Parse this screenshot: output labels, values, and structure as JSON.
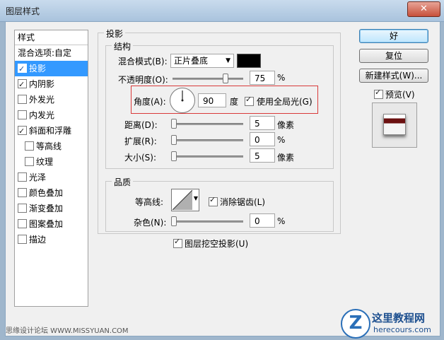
{
  "window": {
    "title": "图层样式",
    "close_label": "✕"
  },
  "left_panel": {
    "header": "样式",
    "items": [
      {
        "label": "混合选项:自定",
        "checkbox": false,
        "checked": false,
        "selected": false,
        "indent": false
      },
      {
        "label": "投影",
        "checkbox": true,
        "checked": true,
        "selected": true,
        "indent": false
      },
      {
        "label": "内阴影",
        "checkbox": true,
        "checked": true,
        "selected": false,
        "indent": false
      },
      {
        "label": "外发光",
        "checkbox": true,
        "checked": false,
        "selected": false,
        "indent": false
      },
      {
        "label": "内发光",
        "checkbox": true,
        "checked": false,
        "selected": false,
        "indent": false
      },
      {
        "label": "斜面和浮雕",
        "checkbox": true,
        "checked": true,
        "selected": false,
        "indent": false
      },
      {
        "label": "等高线",
        "checkbox": true,
        "checked": false,
        "selected": false,
        "indent": true
      },
      {
        "label": "纹理",
        "checkbox": true,
        "checked": false,
        "selected": false,
        "indent": true
      },
      {
        "label": "光泽",
        "checkbox": true,
        "checked": false,
        "selected": false,
        "indent": false
      },
      {
        "label": "颜色叠加",
        "checkbox": true,
        "checked": false,
        "selected": false,
        "indent": false
      },
      {
        "label": "渐变叠加",
        "checkbox": true,
        "checked": false,
        "selected": false,
        "indent": false
      },
      {
        "label": "图案叠加",
        "checkbox": true,
        "checked": false,
        "selected": false,
        "indent": false
      },
      {
        "label": "描边",
        "checkbox": true,
        "checked": false,
        "selected": false,
        "indent": false
      }
    ]
  },
  "shadow": {
    "group_title": "投影",
    "structure_title": "结构",
    "blend_mode_label": "混合模式(B):",
    "blend_mode_value": "正片叠底",
    "shadow_color": "#000000",
    "opacity_label": "不透明度(O):",
    "opacity_value": "75",
    "opacity_unit": "%",
    "angle_label": "角度(A):",
    "angle_value": "90",
    "angle_unit": "度",
    "global_light_label": "使用全局光(G)",
    "global_light_checked": true,
    "distance_label": "距离(D):",
    "distance_value": "5",
    "distance_unit": "像素",
    "spread_label": "扩展(R):",
    "spread_value": "0",
    "spread_unit": "%",
    "size_label": "大小(S):",
    "size_value": "5",
    "size_unit": "像素",
    "quality_title": "品质",
    "contour_label": "等高线:",
    "antialias_label": "消除锯齿(L)",
    "antialias_checked": true,
    "noise_label": "杂色(N):",
    "noise_value": "0",
    "noise_unit": "%",
    "knockout_label": "图层挖空投影(U)",
    "knockout_checked": true
  },
  "right_panel": {
    "ok_label": "好",
    "reset_label": "复位",
    "new_style_label": "新建样式(W)...",
    "preview_label": "预览(V)",
    "preview_checked": true
  },
  "watermark": {
    "left_text": "思缘设计论坛 WWW.MISSYUAN.COM",
    "logo_letter": "Z",
    "logo_title": "这里教程网",
    "logo_url_text": "herecours.com"
  },
  "colors": {
    "selected_bg": "#3399ff",
    "highlight_box": "#d93a3a",
    "title_bar": "#b9d1ea"
  }
}
